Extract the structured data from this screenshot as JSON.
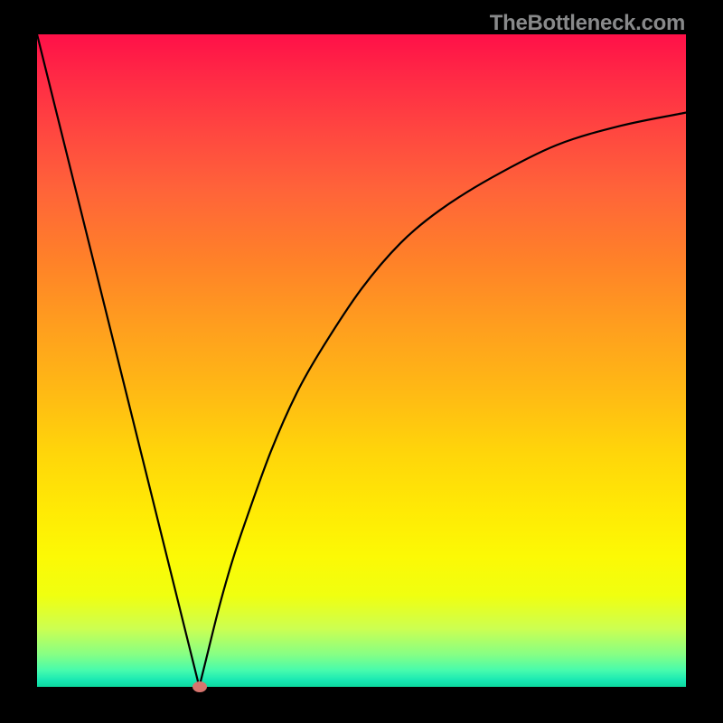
{
  "watermark": "TheBottleneck.com",
  "chart_data": {
    "type": "line",
    "title": "",
    "xlabel": "",
    "ylabel": "",
    "xlim": [
      0,
      100
    ],
    "ylim": [
      0,
      100
    ],
    "x": [
      0,
      4,
      8,
      12,
      16,
      20,
      24,
      25,
      26,
      28,
      30,
      32,
      36,
      40,
      44,
      50,
      56,
      62,
      70,
      80,
      90,
      100
    ],
    "values": [
      100,
      84,
      68,
      52,
      36,
      20,
      4,
      0,
      4,
      12,
      19,
      25,
      36,
      45,
      52,
      61,
      68,
      73,
      78,
      83,
      86,
      88
    ],
    "marker": {
      "x": 25,
      "y": 0
    },
    "grid": false,
    "legend": false
  }
}
